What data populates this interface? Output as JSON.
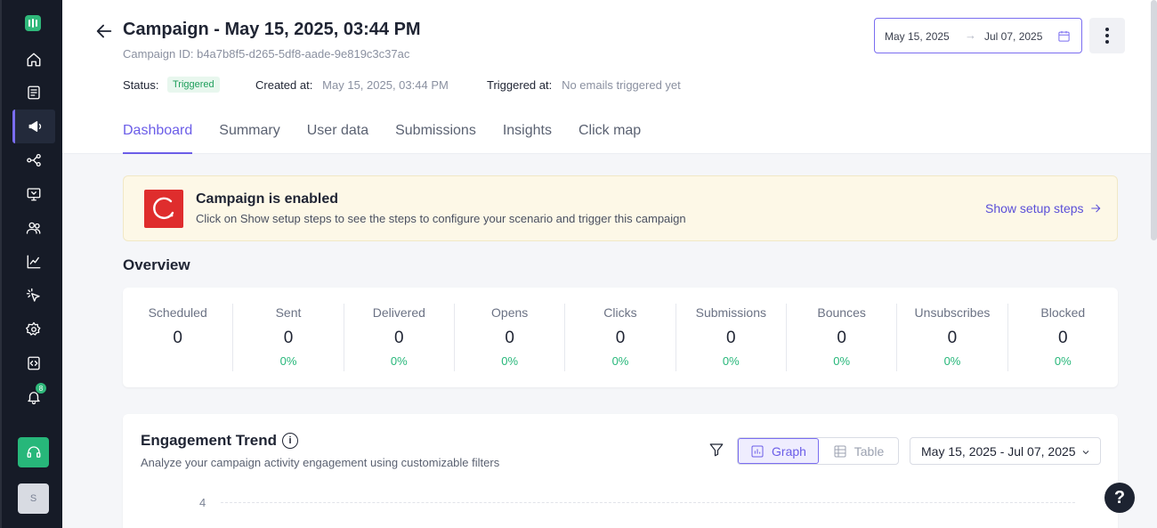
{
  "sidebar": {
    "bell_count": "8",
    "user_initial": "S"
  },
  "header": {
    "title": "Campaign - May 15, 2025, 03:44 PM",
    "campaign_id": "Campaign ID: b4a7b8f5-d265-5df8-aade-9e819c3c37ac",
    "status_label": "Status:",
    "status_value": "Triggered",
    "created_label": "Created at:",
    "created_value": "May 15, 2025, 03:44 PM",
    "triggered_label": "Triggered at:",
    "triggered_value": "No emails triggered yet",
    "date_from": "May 15, 2025",
    "date_arrow": "→",
    "date_to": "Jul 07, 2025"
  },
  "tabs": [
    {
      "label": "Dashboard",
      "active": true
    },
    {
      "label": "Summary"
    },
    {
      "label": "User data"
    },
    {
      "label": "Submissions"
    },
    {
      "label": "Insights"
    },
    {
      "label": "Click map"
    }
  ],
  "banner": {
    "title": "Campaign is enabled",
    "description": "Click on Show setup steps to see the steps to configure your scenario and trigger this campaign",
    "link": "Show setup steps"
  },
  "overview": {
    "title": "Overview",
    "stats": [
      {
        "label": "Scheduled",
        "value": "0",
        "pct": ""
      },
      {
        "label": "Sent",
        "value": "0",
        "pct": "0%"
      },
      {
        "label": "Delivered",
        "value": "0",
        "pct": "0%"
      },
      {
        "label": "Opens",
        "value": "0",
        "pct": "0%"
      },
      {
        "label": "Clicks",
        "value": "0",
        "pct": "0%"
      },
      {
        "label": "Submissions",
        "value": "0",
        "pct": "0%"
      },
      {
        "label": "Bounces",
        "value": "0",
        "pct": "0%"
      },
      {
        "label": "Unsubscribes",
        "value": "0",
        "pct": "0%"
      },
      {
        "label": "Blocked",
        "value": "0",
        "pct": "0%"
      }
    ]
  },
  "engagement": {
    "title": "Engagement Trend",
    "info": "i",
    "description": "Analyze your campaign activity engagement using customizable filters",
    "graph_label": "Graph",
    "table_label": "Table",
    "range": "May 15, 2025 - Jul 07, 2025",
    "y_tick": "4"
  },
  "help": "?"
}
